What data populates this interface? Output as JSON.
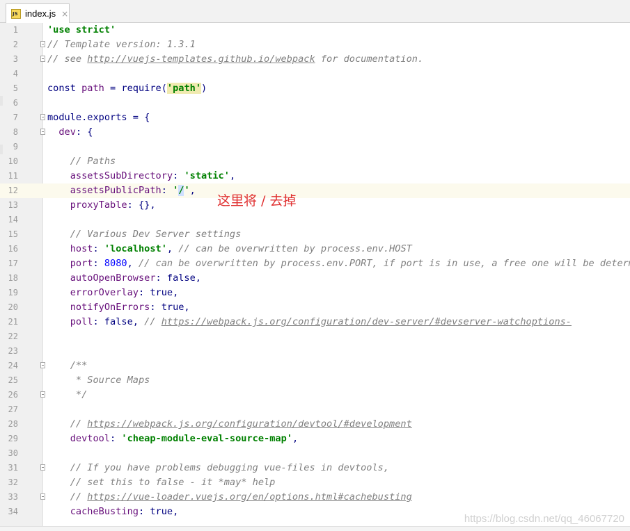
{
  "tab": {
    "label": "index.js",
    "icon": "js-file-icon",
    "close": "×"
  },
  "annotation": "这里将 / 去掉",
  "watermark": "https://blog.csdn.net/qq_46067720",
  "current_line": 12,
  "lines": [
    {
      "n": "1",
      "fold": false,
      "segs": [
        {
          "c": "str",
          "t": "'use strict'"
        }
      ]
    },
    {
      "n": "2",
      "fold": true,
      "segs": [
        {
          "c": "cm",
          "t": "// Template version: 1.3.1"
        }
      ]
    },
    {
      "n": "3",
      "fold": true,
      "segs": [
        {
          "c": "cm",
          "t": "// see "
        },
        {
          "c": "url",
          "t": "http://vuejs-templates.github.io/webpack"
        },
        {
          "c": "cm",
          "t": " for documentation."
        }
      ]
    },
    {
      "n": "4",
      "fold": false,
      "segs": []
    },
    {
      "n": "5",
      "fold": false,
      "segs": [
        {
          "c": "kw",
          "t": "const "
        },
        {
          "c": "prop",
          "t": "path"
        },
        {
          "c": "kw",
          "t": " = require("
        },
        {
          "c": "str hl",
          "t": "'path'"
        },
        {
          "c": "kw",
          "t": ")"
        }
      ]
    },
    {
      "n": "6",
      "fold": false,
      "segs": []
    },
    {
      "n": "7",
      "fold": true,
      "segs": [
        {
          "c": "kw",
          "t": "module.exports = {"
        }
      ]
    },
    {
      "n": "8",
      "fold": true,
      "segs": [
        {
          "c": "kw",
          "t": "  "
        },
        {
          "c": "prop",
          "t": "dev"
        },
        {
          "c": "kw",
          "t": ": {"
        }
      ]
    },
    {
      "n": "9",
      "fold": false,
      "segs": []
    },
    {
      "n": "10",
      "fold": false,
      "segs": [
        {
          "c": "cm",
          "t": "    // Paths"
        }
      ]
    },
    {
      "n": "11",
      "fold": false,
      "segs": [
        {
          "c": "kw",
          "t": "    "
        },
        {
          "c": "prop",
          "t": "assetsSubDirectory"
        },
        {
          "c": "kw",
          "t": ": "
        },
        {
          "c": "str",
          "t": "'static'"
        },
        {
          "c": "kw",
          "t": ","
        }
      ]
    },
    {
      "n": "12",
      "fold": false,
      "segs": [
        {
          "c": "kw",
          "t": "    "
        },
        {
          "c": "prop",
          "t": "assetsPublicPath"
        },
        {
          "c": "kw",
          "t": ": "
        },
        {
          "c": "str",
          "t": "'"
        },
        {
          "c": "str caret-sel",
          "t": "/"
        },
        {
          "c": "str",
          "t": "'"
        },
        {
          "c": "kw",
          "t": ","
        }
      ]
    },
    {
      "n": "13",
      "fold": false,
      "segs": [
        {
          "c": "kw",
          "t": "    "
        },
        {
          "c": "prop",
          "t": "proxyTable"
        },
        {
          "c": "kw",
          "t": ": {},"
        }
      ]
    },
    {
      "n": "14",
      "fold": false,
      "segs": []
    },
    {
      "n": "15",
      "fold": false,
      "segs": [
        {
          "c": "cm",
          "t": "    // Various Dev Server settings"
        }
      ]
    },
    {
      "n": "16",
      "fold": false,
      "segs": [
        {
          "c": "kw",
          "t": "    "
        },
        {
          "c": "prop",
          "t": "host"
        },
        {
          "c": "kw",
          "t": ": "
        },
        {
          "c": "str",
          "t": "'localhost'"
        },
        {
          "c": "kw",
          "t": ", "
        },
        {
          "c": "cm",
          "t": "// can be overwritten by process.env.HOST"
        }
      ]
    },
    {
      "n": "17",
      "fold": false,
      "segs": [
        {
          "c": "kw",
          "t": "    "
        },
        {
          "c": "prop",
          "t": "port"
        },
        {
          "c": "kw",
          "t": ": "
        },
        {
          "c": "num",
          "t": "8080"
        },
        {
          "c": "kw",
          "t": ", "
        },
        {
          "c": "cm",
          "t": "// can be overwritten by process.env.PORT, if port is in use, a free one will be determined"
        }
      ]
    },
    {
      "n": "18",
      "fold": false,
      "segs": [
        {
          "c": "kw",
          "t": "    "
        },
        {
          "c": "prop",
          "t": "autoOpenBrowser"
        },
        {
          "c": "kw",
          "t": ": false,"
        }
      ]
    },
    {
      "n": "19",
      "fold": false,
      "segs": [
        {
          "c": "kw",
          "t": "    "
        },
        {
          "c": "prop",
          "t": "errorOverlay"
        },
        {
          "c": "kw",
          "t": ": true,"
        }
      ]
    },
    {
      "n": "20",
      "fold": false,
      "segs": [
        {
          "c": "kw",
          "t": "    "
        },
        {
          "c": "prop",
          "t": "notifyOnErrors"
        },
        {
          "c": "kw",
          "t": ": true,"
        }
      ]
    },
    {
      "n": "21",
      "fold": false,
      "segs": [
        {
          "c": "kw",
          "t": "    "
        },
        {
          "c": "prop",
          "t": "poll"
        },
        {
          "c": "kw",
          "t": ": false, "
        },
        {
          "c": "cm",
          "t": "// "
        },
        {
          "c": "url",
          "t": "https://webpack.js.org/configuration/dev-server/#devserver-watchoptions-"
        }
      ]
    },
    {
      "n": "22",
      "fold": false,
      "segs": []
    },
    {
      "n": "23",
      "fold": false,
      "segs": []
    },
    {
      "n": "24",
      "fold": true,
      "segs": [
        {
          "c": "cm",
          "t": "    /**"
        }
      ]
    },
    {
      "n": "25",
      "fold": false,
      "segs": [
        {
          "c": "cm",
          "t": "     * Source Maps"
        }
      ]
    },
    {
      "n": "26",
      "fold": true,
      "segs": [
        {
          "c": "cm",
          "t": "     */"
        }
      ]
    },
    {
      "n": "27",
      "fold": false,
      "segs": []
    },
    {
      "n": "28",
      "fold": false,
      "segs": [
        {
          "c": "cm",
          "t": "    // "
        },
        {
          "c": "url",
          "t": "https://webpack.js.org/configuration/devtool/#development"
        }
      ]
    },
    {
      "n": "29",
      "fold": false,
      "segs": [
        {
          "c": "kw",
          "t": "    "
        },
        {
          "c": "prop",
          "t": "devtool"
        },
        {
          "c": "kw",
          "t": ": "
        },
        {
          "c": "str",
          "t": "'cheap-module-eval-source-map'"
        },
        {
          "c": "kw",
          "t": ","
        }
      ]
    },
    {
      "n": "30",
      "fold": false,
      "segs": []
    },
    {
      "n": "31",
      "fold": true,
      "segs": [
        {
          "c": "cm",
          "t": "    // If you have problems debugging vue-files in devtools,"
        }
      ]
    },
    {
      "n": "32",
      "fold": false,
      "segs": [
        {
          "c": "cm",
          "t": "    // set this to false - it *may* help"
        }
      ]
    },
    {
      "n": "33",
      "fold": true,
      "segs": [
        {
          "c": "cm",
          "t": "    // "
        },
        {
          "c": "url",
          "t": "https://vue-loader.vuejs.org/en/options.html#cachebusting"
        }
      ]
    },
    {
      "n": "34",
      "fold": false,
      "segs": [
        {
          "c": "kw",
          "t": "    "
        },
        {
          "c": "prop",
          "t": "cacheBusting"
        },
        {
          "c": "kw",
          "t": ": true,"
        }
      ]
    }
  ]
}
